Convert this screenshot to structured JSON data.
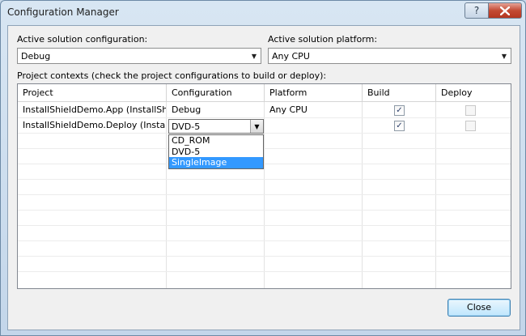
{
  "window": {
    "title": "Configuration Manager",
    "help_label": "?",
    "close_icon": "close-icon"
  },
  "active_config": {
    "label": "Active solution configuration:",
    "value": "Debug"
  },
  "active_platform": {
    "label": "Active solution platform:",
    "value": "Any CPU"
  },
  "project_contexts_label": "Project contexts (check the project configurations to build or deploy):",
  "grid": {
    "headers": [
      "Project",
      "Configuration",
      "Platform",
      "Build",
      "Deploy"
    ],
    "rows": [
      {
        "project": "InstallShieldDemo.App (InstallShiel...",
        "configuration": "Debug",
        "platform": "Any CPU",
        "build": true,
        "deploy": false
      },
      {
        "project": "InstallShieldDemo.Deploy (InstallS...",
        "configuration": "DVD-5",
        "platform": "",
        "build": true,
        "deploy": false
      }
    ]
  },
  "dropdown": {
    "options": [
      "CD_ROM",
      "DVD-5",
      "SingleImage"
    ],
    "highlighted": "SingleImage"
  },
  "close_button": "Close",
  "colors": {
    "highlight": "#3399ff",
    "close_red": "#c34a33"
  }
}
